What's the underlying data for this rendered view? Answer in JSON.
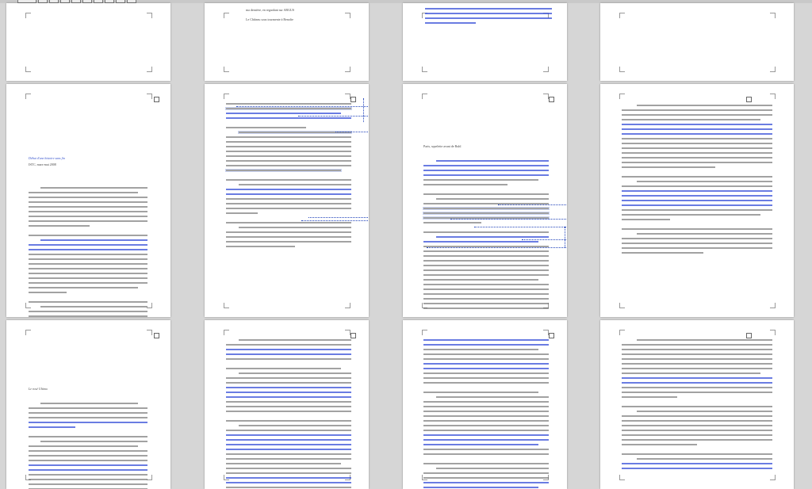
{
  "document": {
    "pages": [
      {
        "id": "p1",
        "has_text": false
      },
      {
        "id": "p2",
        "top_lines": [
          "ma dernière, en regardant sur ARGUS",
          "Le Château sous tourmente à Benoîte"
        ]
      },
      {
        "id": "p3",
        "has_text": true
      },
      {
        "id": "p4",
        "has_text": false
      },
      {
        "id": "p5",
        "header_line1": "Début d'une histoire sans fin",
        "header_line2": "ISTC, mars-mai 2008"
      },
      {
        "id": "p6",
        "has_comments": true,
        "comment_count": 5
      },
      {
        "id": "p7",
        "header": "Paris, squelette avant de Ruhl",
        "has_comments": true,
        "comment_count": 5
      },
      {
        "id": "p8",
        "has_text": true
      },
      {
        "id": "p9",
        "header": "Le rosé Ultimo"
      },
      {
        "id": "p10",
        "has_text": true
      },
      {
        "id": "p11",
        "has_text": true
      },
      {
        "id": "p12",
        "has_text": true
      }
    ]
  }
}
